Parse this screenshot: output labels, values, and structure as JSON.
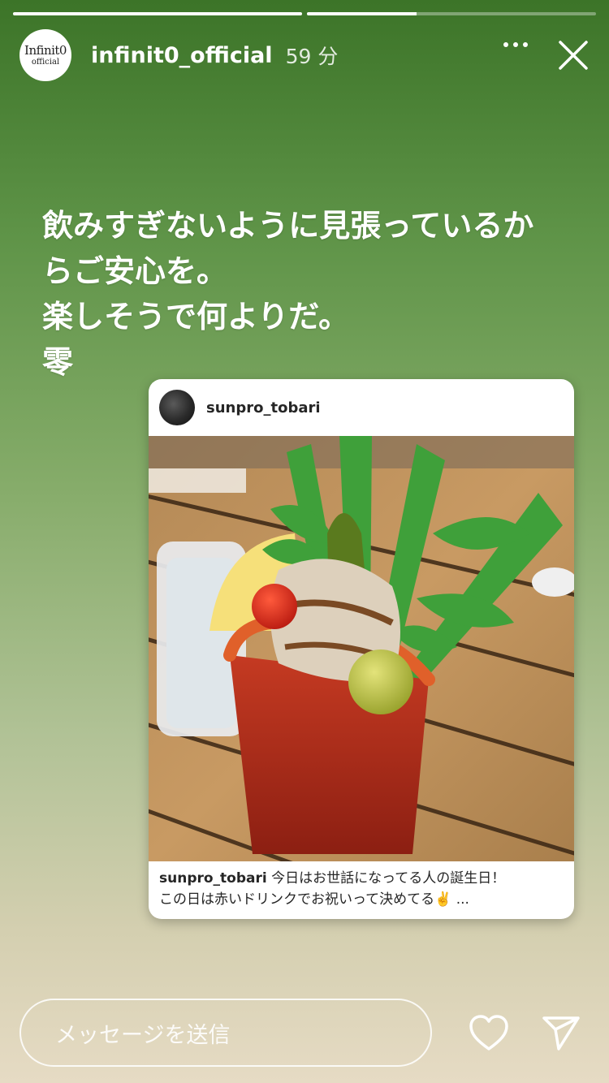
{
  "story": {
    "progress": [
      1.0,
      0.38
    ],
    "user": {
      "username": "infinit0_official",
      "time": "59 分",
      "avatar_line1": "Infinit0",
      "avatar_line2": "official"
    },
    "caption_lines": [
      "飲みすぎないように見張っているか",
      "らご安心を。",
      "楽しそうで何よりだ。",
      "零"
    ]
  },
  "shared_post": {
    "username": "sunpro_tobari",
    "caption_user": "sunpro_tobari",
    "caption_line1": "今日はお世話になってる人の誕生日！",
    "caption_line2": "この日は赤いドリンクでお祝いって決めてる✌️ ..."
  },
  "footer": {
    "message_placeholder": "メッセージを送信"
  },
  "icons": {
    "more": "more-dots-icon",
    "close": "close-icon",
    "like": "heart-icon",
    "send": "send-icon"
  }
}
